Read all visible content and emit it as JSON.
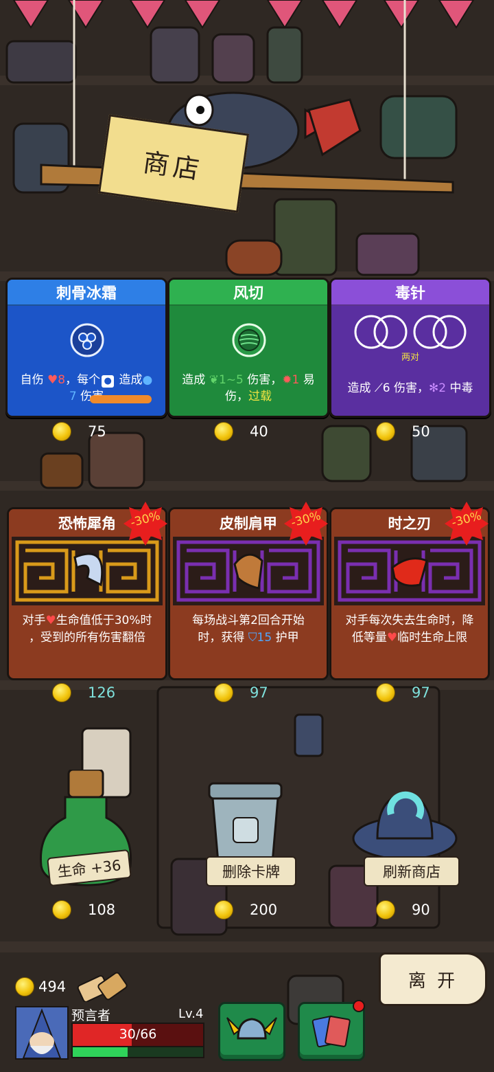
{
  "shop": {
    "title": "商店"
  },
  "cards": [
    {
      "name": "刺骨冰霜",
      "line1": "自伤 ",
      "v1": "8",
      "line1b": "，每个",
      "line1c": " 造成",
      "v2": "7",
      "line2": " 伤害",
      "price": "75",
      "color": "#1c55c8",
      "headerColor": "#2e7fe6"
    },
    {
      "name": "风切",
      "line1": "造成 ",
      "v1": "1~5",
      "line1b": " 伤害，",
      "v2": "1",
      "line1c": " 易",
      "line2a": "伤，",
      "line2b": "过载",
      "price": "40",
      "color": "#1f8a3c",
      "headerColor": "#2fb150"
    },
    {
      "name": "毒针",
      "pair": "两对",
      "line1": "造成 ",
      "v1": "6",
      "line1b": " 伤害，",
      "v2": "2",
      "line1c": " 中毒",
      "price": "50",
      "color": "#5a2fa0",
      "headerColor": "#8b4fd8"
    }
  ],
  "relics": [
    {
      "name": "恐怖犀角",
      "discount": "-30%",
      "desc1": "对手",
      "desc1b": "生命值低于30%时",
      "desc2": "，受到的所有伤害翻倍",
      "price": "126"
    },
    {
      "name": "皮制肩甲",
      "discount": "-30%",
      "desc1": "每场战斗第2回合开始",
      "desc2": "时，获得 ",
      "desc2v": "15",
      "desc2b": " 护甲",
      "price": "97"
    },
    {
      "name": "时之刃",
      "discount": "-30%",
      "desc1": "对手每次失去生命时，降",
      "desc2": "低等量",
      "desc2b": "临时生命上限",
      "price": "97"
    }
  ],
  "services": [
    {
      "label": "生命 +36",
      "price": "108"
    },
    {
      "label": "删除卡牌",
      "price": "200"
    },
    {
      "label": "刷新商店",
      "price": "90"
    }
  ],
  "leave": {
    "label": "离 开"
  },
  "player": {
    "gold": "494",
    "name": "预言者",
    "level": "Lv.4",
    "hp": "30/66",
    "hp_fraction": 0.455,
    "xp_fraction": 0.42
  },
  "colors": {
    "hp": "#e02626",
    "xp": "#2fd35a",
    "coin": "#f2c40c",
    "cyan_price": "#7fe1dc"
  }
}
